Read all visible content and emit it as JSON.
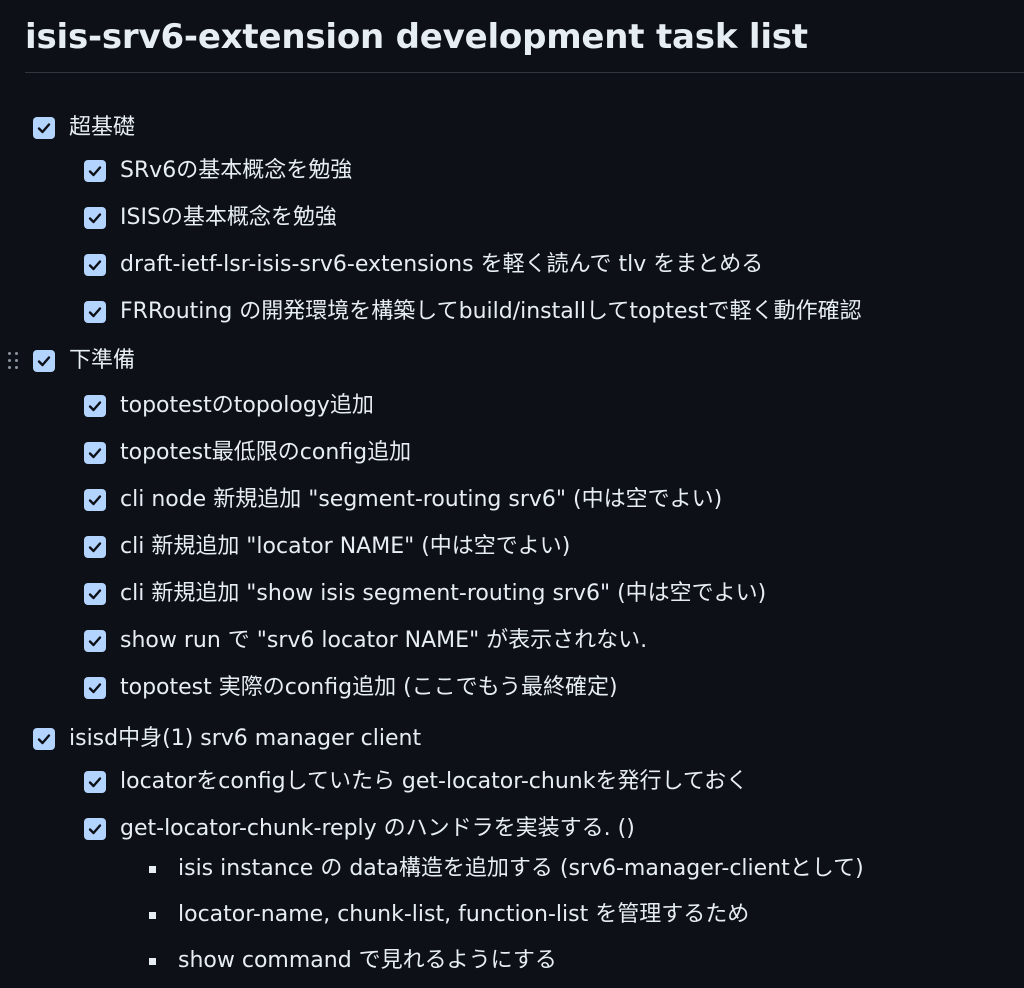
{
  "page": {
    "title": "isis-srv6-extension development task list"
  },
  "groups": [
    {
      "label": "超基礎",
      "checked": true,
      "items": [
        "SRv6の基本概念を勉強",
        "ISISの基本概念を勉強",
        "draft-ietf-lsr-isis-srv6-extensions を軽く読んで tlv をまとめる",
        "FRRouting の開発環境を構築してbuild/installしてtoptestで軽く動作確認"
      ]
    },
    {
      "label": "下準備",
      "checked": true,
      "items": [
        "topotestのtopology追加",
        "topotest最低限のconfig追加",
        "cli node 新規追加 \"segment-routing srv6\" (中は空でよい)",
        "cli 新規追加 \"locator NAME\" (中は空でよい)",
        "cli 新規追加 \"show isis segment-routing srv6\" (中は空でよい)",
        "show run で \"srv6 locator NAME\" が表示されない.",
        "topotest 実際のconfig追加 (ここでもう最終確定)"
      ]
    },
    {
      "label": "isisd中身(1) srv6 manager client",
      "checked": true,
      "items": [
        "locatorをconfigしていたら get-locator-chunkを発行しておく",
        "get-locator-chunk-reply のハンドラを実装する. ()"
      ],
      "subitems": [
        "isis instance の data構造を追加する (srv6-manager-clientとして)",
        "locator-name, chunk-list, function-list を管理するため",
        "show command で見れるようにする"
      ]
    }
  ],
  "colors": {
    "background": "#0d1117",
    "text": "#e6edf3",
    "checkbox": "#b3d4ff",
    "checkmark": "#0d1117",
    "divider": "#30363d"
  },
  "icons": {
    "checkbox": "checkbox-checked-icon",
    "drag": "drag-handle-icon",
    "bullet": "square-bullet-icon"
  }
}
